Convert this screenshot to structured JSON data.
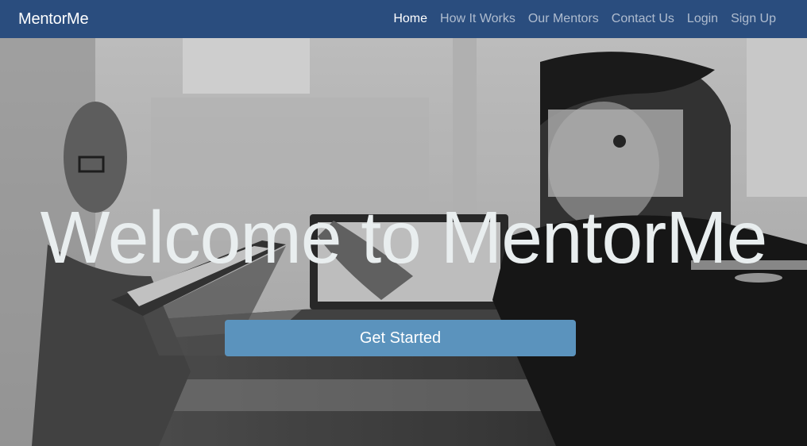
{
  "navbar": {
    "brand": "MentorMe",
    "links": [
      {
        "label": "Home",
        "active": true
      },
      {
        "label": "How It Works",
        "active": false
      },
      {
        "label": "Our Mentors",
        "active": false
      },
      {
        "label": "Contact Us",
        "active": false
      },
      {
        "label": "Login",
        "active": false
      },
      {
        "label": "Sign Up",
        "active": false
      }
    ]
  },
  "hero": {
    "title": "Welcome to MentorMe",
    "cta_label": "Get Started",
    "background_description": "Grayscale photo of two people working on laptops at a desk"
  },
  "colors": {
    "navbar_bg": "#2a4d7e",
    "cta_bg": "#5b93bd",
    "title_text": "#e9eeef"
  }
}
